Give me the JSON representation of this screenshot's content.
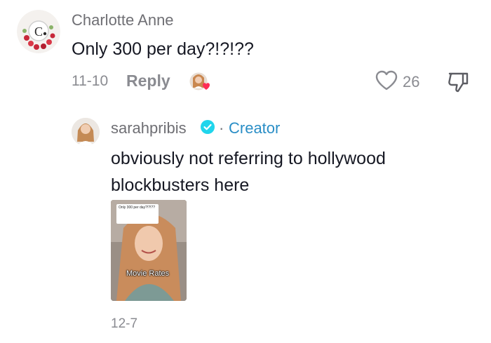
{
  "comment": {
    "author": "Charlotte Anne",
    "text": "Only 300 per day?!?!??",
    "date": "11-10",
    "reply_label": "Reply",
    "like_count": "26"
  },
  "reply": {
    "author": "sarahpribis",
    "separator": "·",
    "creator_label": "Creator",
    "text": "obviously not referring to hollywood blockbusters here",
    "video_thumb": {
      "card_text": "Only 300 per day?!?!??",
      "label": "Movie Rates"
    },
    "date": "12-7"
  },
  "colors": {
    "accent_blue": "#2a8ec6",
    "verified": "#20d5ec",
    "heart_badge": "#fe2c55",
    "muted_text": "#8a8b91"
  }
}
